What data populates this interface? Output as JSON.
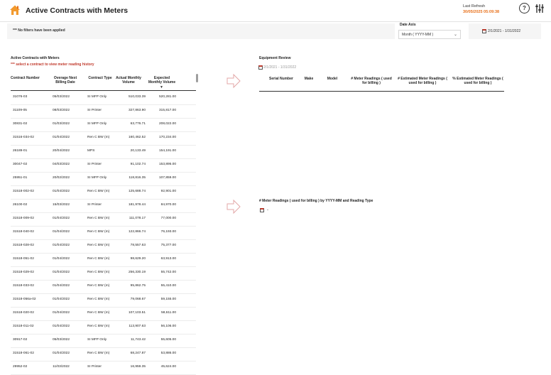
{
  "app": {
    "title": "Active Contracts with Meters",
    "last_refresh_label": "Last Refresh",
    "last_refresh_value": "30/05/2025 05:09:38",
    "help_label": "?"
  },
  "filters": {
    "applied_text": "*** No filters have been applied",
    "date_axis_label": "Date Axis",
    "date_axis_value": "Month ( YYYY-MM )",
    "date_range": "2/1/2021 - 1/31/2022"
  },
  "contracts": {
    "section_title": "Active Contracts with Meters",
    "hint": "*** select a contract to view meter reading history",
    "columns": [
      "Contract Number",
      "Overage Next Billing Date",
      "Contract Type",
      "Actual Monthly Volume",
      "Expected Monthly Volume"
    ],
    "rows": [
      [
        "31076-03",
        "05/03/2022",
        "SI MFP Only",
        "510,033.39",
        "520,281.00"
      ],
      [
        "31109-05",
        "08/03/2022",
        "SI Printer",
        "327,863.90",
        "315,817.00"
      ],
      [
        "30831-02",
        "01/03/2022",
        "SI MFP Only",
        "63,776.71",
        "208,022.00"
      ],
      [
        "31516-034-02",
        "01/04/2022",
        "Ren C BW (m)",
        "160,462.52",
        "170,234.00"
      ],
      [
        "26189-01",
        "20/04/2022",
        "MPS",
        "20,133.49",
        "154,191.00"
      ],
      [
        "30047-02",
        "04/03/2022",
        "SI Printer",
        "91,102.74",
        "153,895.00"
      ],
      [
        "25951-01",
        "20/02/2022",
        "SI MFP Only",
        "118,816.35",
        "107,859.00"
      ],
      [
        "31518-002-02",
        "01/04/2022",
        "Ren C BW (m)",
        "125,688.74",
        "92,901.00"
      ],
      [
        "26100-02",
        "15/03/2022",
        "SI Printer",
        "181,978.44",
        "84,970.00"
      ],
      [
        "31518-009-02",
        "01/04/2022",
        "Ren C BW (m)",
        "111,078.17",
        "77,000.00"
      ],
      [
        "31518-040-02",
        "01/04/2022",
        "Ren C BW (m)",
        "122,866.74",
        "76,193.00"
      ],
      [
        "31518-028-02",
        "01/04/2022",
        "Ren C BW (m)",
        "78,557.63",
        "75,377.00"
      ],
      [
        "31518-051-02",
        "01/04/2022",
        "Ren C BW (m)",
        "98,629.20",
        "63,913.00"
      ],
      [
        "31518-029-02",
        "01/04/2022",
        "Ren C BW (m)",
        "256,330.19",
        "55,742.00"
      ],
      [
        "31518-033-02",
        "01/04/2022",
        "Ren C BW (m)",
        "95,862.75",
        "55,410.00"
      ],
      [
        "31518-056a-02",
        "01/04/2022",
        "Ren C BW (m)",
        "79,068.67",
        "59,155.00"
      ],
      [
        "31518-020-02",
        "01/04/2022",
        "Ren C BW (m)",
        "107,103.51",
        "58,611.00"
      ],
      [
        "31518-011-02",
        "01/04/2022",
        "Ren C BW (m)",
        "113,907.63",
        "56,106.00"
      ],
      [
        "30917-02",
        "05/03/2022",
        "SI MFP Only",
        "11,743.42",
        "55,605.00"
      ],
      [
        "31518-061-02",
        "01/04/2022",
        "Ren C BW (m)",
        "68,247.87",
        "53,886.00"
      ],
      [
        "29952-02",
        "11/03/2022",
        "SI Printer",
        "16,959.35",
        "45,624.00"
      ]
    ]
  },
  "equipment": {
    "section_title": "Equipment Review",
    "date_range": "2/1/2021 - 1/31/2022",
    "columns": [
      "Serial Number",
      "Make",
      "Model",
      "# Meter Readings ( used for billing )",
      "# Estimated Meter Readings ( used for billing )",
      "% Estimated Meter Readings ( used for billing )"
    ]
  },
  "meter_readings": {
    "section_title": "# Meter Readings ( used for billing ) by YYYY-MM and Reading Type",
    "value": "-"
  },
  "colors": {
    "accent": "#e8701a",
    "hint": "#c0392b",
    "logo": "#f29a2e"
  },
  "icons": [
    "home-logo-icon",
    "help-icon",
    "settings-sliders-icon",
    "calendar-icon",
    "chevron-down-icon",
    "arrow-right-icon"
  ]
}
